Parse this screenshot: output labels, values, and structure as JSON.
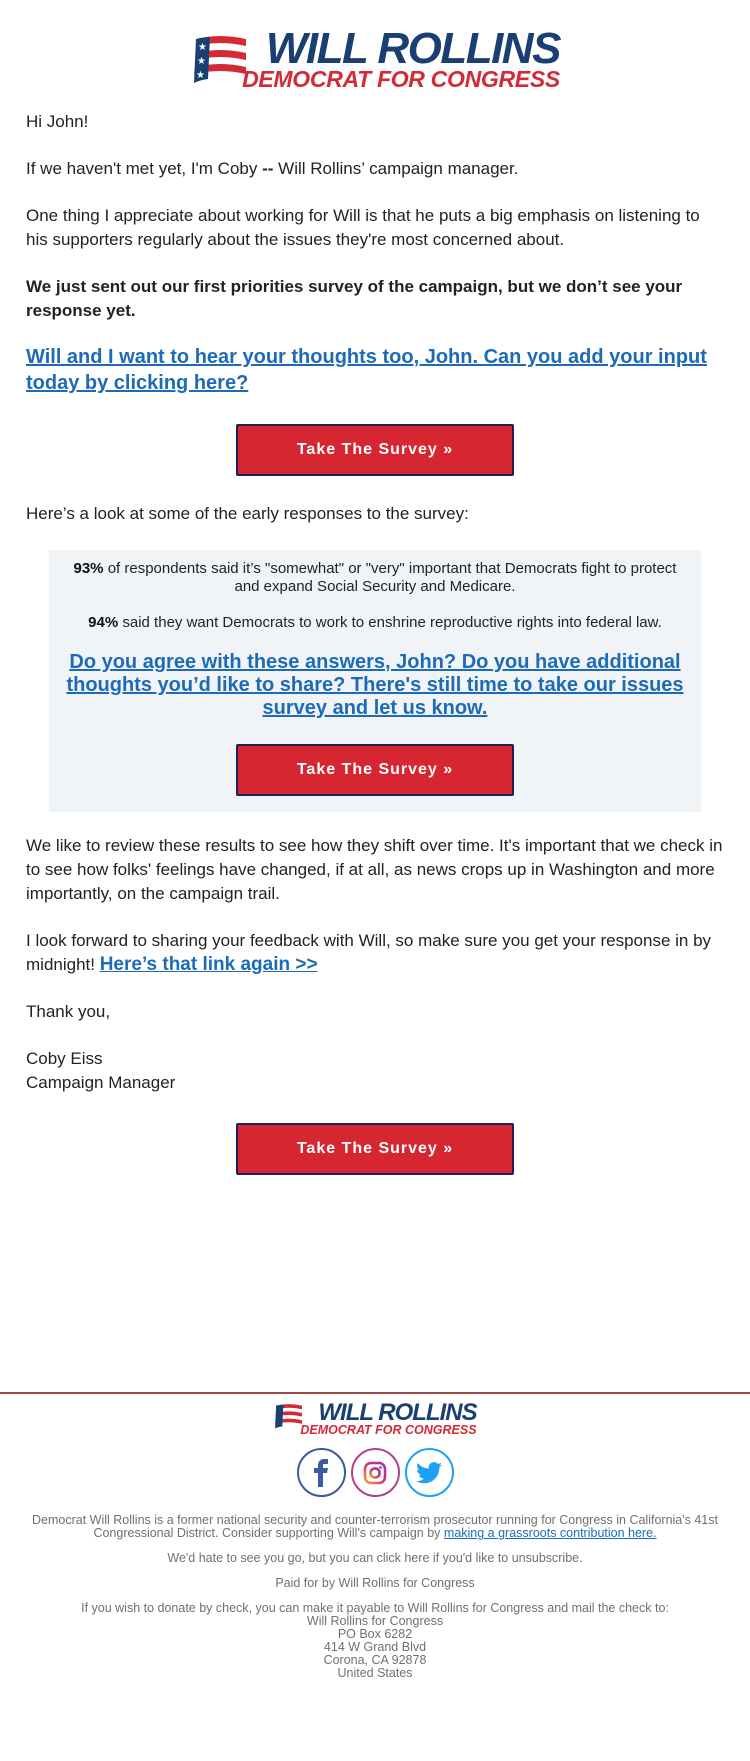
{
  "header": {
    "logo_name": "WILL ROLLINS",
    "logo_tagline": "DEMOCRAT FOR CONGRESS"
  },
  "email": {
    "greeting": "Hi John!",
    "intro_pre": "If we haven't met yet, I'm Coby ",
    "intro_dash": "--",
    "intro_post": " Will Rollins’ campaign manager.",
    "para_listen": "One thing I appreciate about working for Will is that he puts a big emphasis on listening to his supporters regularly about the issues they're most concerned about.",
    "para_bold": "We just sent out our first priorities survey of the campaign, but we don’t see your response yet.",
    "link_input": "Will and I want to hear your thoughts too, John. Can you add your input today by clicking here?",
    "button_label": "Take The Survey »",
    "early_responses": "Here’s a look at some of the early responses to the survey:",
    "stats": [
      {
        "value": "93%",
        "text": " of respondents said it’s \"somewhat\" or \"very\" important that Democrats fight to protect and expand Social Security and Medicare."
      },
      {
        "value": "94%",
        "text": " said they want Democrats to work to enshrine reproductive rights into federal law."
      }
    ],
    "box_link": "Do you agree with these answers, John? Do you have additional thoughts you’d like to share? There's still time to take our issues survey and let us know.",
    "para_review": "We like to review these results to see how they shift over time. It's important that we check in to see how folks' feelings have changed, if at all, as news crops up in Washington and more importantly, on the campaign trail.",
    "para_forward": "I look forward to sharing your feedback with Will, so make sure you get your response in by midnight! ",
    "link_again": "Here’s that link again >>",
    "thanks": "Thank you,",
    "signer_name": "Coby Eiss",
    "signer_title": "Campaign Manager"
  },
  "footer": {
    "logo_name": "WILL ROLLINS",
    "logo_tagline": "DEMOCRAT FOR CONGRESS",
    "social": [
      {
        "name": "facebook-icon",
        "color": "#3b5aa0"
      },
      {
        "name": "instagram-icon",
        "color": "#b0418b"
      },
      {
        "name": "twitter-icon",
        "color": "#1da1f2"
      }
    ],
    "about": "Democrat Will Rollins is a former national security and counter-terrorism prosecutor running for Congress in California's 41st Congressional District. Consider supporting Will's campaign by ",
    "contribute_link": "making a grassroots contribution here.",
    "unsubscribe": "We'd hate to see you go, but you can click here if you'd like to unsubscribe.",
    "paid_for": "Paid for by Will Rollins for Congress",
    "check_text": "If you wish to donate by check, you can make it payable to Will Rollins for Congress and mail the check to:",
    "address": [
      "Will Rollins for Congress",
      "PO Box 6282",
      "414 W Grand Blvd",
      "Corona, CA 92878",
      "United States"
    ]
  },
  "colors": {
    "brand_blue": "#1a3f72",
    "brand_red": "#d42a35",
    "button_red": "#d62631",
    "link_blue": "#1d6bb8"
  }
}
